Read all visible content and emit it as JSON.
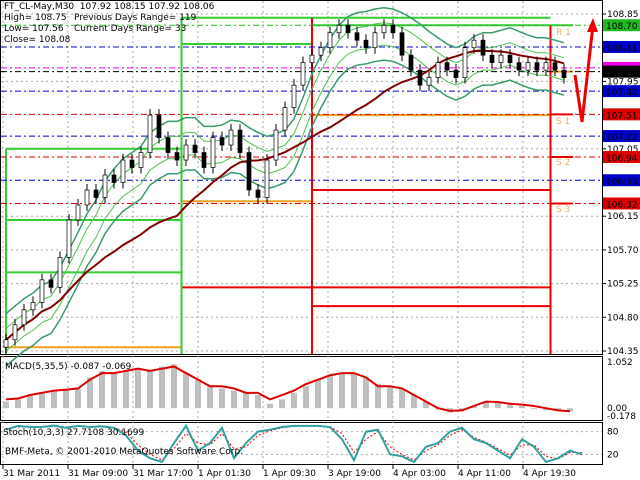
{
  "header": {
    "symbol_line": "FT_CL-May,M30  107.92 108.15 107.92 108.06",
    "high": "High= 108.75",
    "prev_range": "Previous Days Range= 119",
    "low": "Low= 107.56",
    "cur_range": "Current Days Range= 33",
    "close": "Close= 108.08"
  },
  "macd_label": "MACD(5,35,5) -0.087 -0.069",
  "stoch_label": "Stoch(10,3,3) 27.7108 30.1699",
  "copyright": "BMF-Meta, © 2001-2010 MetaQuotes Software Corp.",
  "pivot_labels": [
    "R 1",
    "S 1",
    "S 2",
    "S 3"
  ],
  "chart_data": {
    "type": "candlestick",
    "ylim": [
      104.35,
      108.85
    ],
    "price_ticks": [
      "108.85",
      "107.95",
      "107.05",
      "106.15",
      "105.70",
      "105.25",
      "104.80",
      "104.35"
    ],
    "price_tick_values": [
      108.85,
      107.95,
      107.05,
      106.15,
      105.7,
      105.25,
      104.8,
      104.35
    ],
    "level_tags": [
      {
        "text": "108.70",
        "value": 108.7,
        "color": "#22b822"
      },
      {
        "text": "108.41",
        "value": 108.41,
        "color": "#0000cc"
      },
      {
        "text": "108.13",
        "value": 108.13,
        "color": "#ee00ee"
      },
      {
        "text": "108.08",
        "value": 108.08,
        "color": "#000000"
      },
      {
        "text": "107.82",
        "value": 107.82,
        "color": "#0000cc"
      },
      {
        "text": "107.51",
        "value": 107.51,
        "color": "#dd0000"
      },
      {
        "text": "107.22",
        "value": 107.22,
        "color": "#0000cc"
      },
      {
        "text": "106.94",
        "value": 106.94,
        "color": "#dd0000"
      },
      {
        "text": "106.63",
        "value": 106.63,
        "color": "#0000cc"
      },
      {
        "text": "106.32",
        "value": 106.32,
        "color": "#dd0000"
      }
    ],
    "time_labels": [
      "31 Mar 2011",
      "31 Mar 09:00",
      "31 Mar 17:00",
      "1 Apr 01:30",
      "1 Apr 09:30",
      "3 Apr 19:00",
      "4 Apr 03:00",
      "4 Apr 11:00",
      "4 Apr 19:30"
    ],
    "closes": [
      104.5,
      104.7,
      104.9,
      105.0,
      105.3,
      105.2,
      105.6,
      106.1,
      106.3,
      106.5,
      106.4,
      106.7,
      106.6,
      106.9,
      106.8,
      107.0,
      107.5,
      107.2,
      107.0,
      106.9,
      107.1,
      107.0,
      106.8,
      107.2,
      107.1,
      107.3,
      107.0,
      106.5,
      106.4,
      106.9,
      107.3,
      107.6,
      107.9,
      108.2,
      108.3,
      108.4,
      108.6,
      108.7,
      108.6,
      108.5,
      108.4,
      108.6,
      108.7,
      108.6,
      108.3,
      108.1,
      107.9,
      108.0,
      108.2,
      108.1,
      108.0,
      108.4,
      108.5,
      108.3,
      108.2,
      108.3,
      108.2,
      108.1,
      108.2,
      108.1,
      108.2,
      108.1,
      108.0
    ],
    "pivot_segments": [
      {
        "from": 0,
        "to": 19.5,
        "green": [
          107.05,
          106.1,
          105.4
        ],
        "orange": 104.4,
        "red": []
      },
      {
        "from": 19.5,
        "to": 34,
        "green": [
          108.8,
          108.45
        ],
        "orange": 106.35,
        "red": [
          105.2
        ]
      },
      {
        "from": 34,
        "to": 60.5,
        "green": [
          108.8,
          108.7
        ],
        "orange": 107.5,
        "red": [
          106.5,
          105.2,
          104.95
        ]
      },
      {
        "from": 60.5,
        "to": 63,
        "green": [
          108.7
        ],
        "orange": 108.08,
        "red": [
          107.51,
          106.94,
          106.32
        ]
      }
    ],
    "macd": {
      "ylim": [
        -0.178,
        1.052
      ],
      "ticks": [
        "1.052",
        "0.00",
        "-0.178"
      ],
      "hist": [
        0.15,
        0.2,
        0.3,
        0.35,
        0.4,
        0.45,
        0.45,
        0.7,
        0.85,
        0.8,
        0.85,
        0.9,
        0.85,
        0.95,
        1.0,
        0.8,
        0.65,
        0.5,
        0.45,
        0.4,
        0.35,
        0.3,
        0.1,
        0.2,
        0.35,
        0.5,
        0.65,
        0.75,
        0.8,
        0.8,
        0.7,
        0.55,
        0.5,
        0.45,
        0.3,
        0.15,
        0.0,
        -0.1,
        -0.05,
        0.05,
        0.15,
        0.12,
        0.1,
        0.05,
        0.0,
        -0.05,
        -0.06,
        -0.07
      ],
      "signal": [
        0.2,
        0.22,
        0.3,
        0.35,
        0.4,
        0.42,
        0.45,
        0.65,
        0.8,
        0.8,
        0.85,
        0.9,
        0.85,
        0.9,
        0.95,
        0.8,
        0.65,
        0.5,
        0.5,
        0.45,
        0.35,
        0.35,
        0.2,
        0.3,
        0.4,
        0.55,
        0.65,
        0.75,
        0.8,
        0.8,
        0.7,
        0.5,
        0.5,
        0.45,
        0.3,
        0.15,
        0.0,
        -0.06,
        -0.05,
        0.05,
        0.15,
        0.14,
        0.1,
        0.08,
        0.05,
        0.0,
        -0.05,
        -0.07
      ]
    },
    "stoch": {
      "ylim": [
        0,
        100
      ],
      "ticks": [
        "80",
        "20"
      ],
      "main": [
        85,
        95,
        92,
        92,
        96,
        90,
        95,
        92,
        94,
        90,
        70,
        30,
        10,
        0,
        50,
        95,
        30,
        50,
        90,
        10,
        50,
        80,
        85,
        92,
        95,
        95,
        95,
        92,
        60,
        5,
        80,
        85,
        20,
        15,
        0,
        40,
        50,
        80,
        90,
        60,
        50,
        30,
        10,
        60,
        40,
        0,
        10,
        30,
        20
      ],
      "signal": [
        88,
        92,
        93,
        92,
        94,
        92,
        93,
        93,
        92,
        91,
        78,
        45,
        20,
        5,
        35,
        75,
        50,
        45,
        75,
        35,
        40,
        70,
        82,
        90,
        94,
        95,
        95,
        93,
        75,
        25,
        60,
        80,
        40,
        20,
        5,
        30,
        45,
        70,
        85,
        65,
        52,
        35,
        18,
        45,
        45,
        15,
        8,
        25,
        25
      ]
    }
  }
}
